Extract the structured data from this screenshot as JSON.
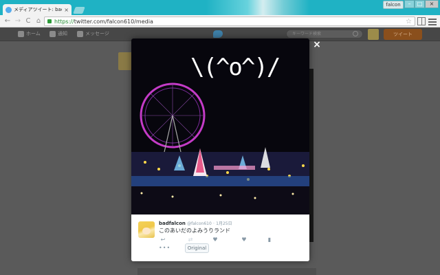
{
  "browser": {
    "tab_title": "メディアツイート: badfalcon",
    "tab_close": "×",
    "url_scheme": "https://",
    "url_rest": "twitter.com/falcon610/media",
    "profile_name": "falcon",
    "window_minimize": "–",
    "window_maximize": "□",
    "window_close": "×",
    "back": "←",
    "forward": "→",
    "reload": "C",
    "home": "⌂",
    "bookmark_star": "☆"
  },
  "twitter_nav": {
    "home": "ホーム",
    "notifications": "通知",
    "messages": "メッセージ",
    "search_placeholder": "キーワード検索",
    "tweet_button": "ツイート"
  },
  "modal": {
    "close": "×",
    "photo_overlay_text": "\\(^o^)/",
    "tweet": {
      "display_name": "badfalcon",
      "handle": "@falcon610",
      "dot": "·",
      "date": "1月25日",
      "text": "このあいだのよみうりランド",
      "more": "•••",
      "original_button": "Original"
    },
    "actions": {
      "reply": "↩",
      "retweet": "⇄",
      "favorite": "♥",
      "like": "♥",
      "stats": "▮"
    }
  },
  "colors": {
    "chrome_frame": "#1fb2c4",
    "twitter_blue": "#55acee",
    "tweet_button_dim": "#8a4f1c",
    "photo_background": "#07060d"
  },
  "icons": [
    "twitter-favicon",
    "lock-icon",
    "star-icon",
    "extension-icon",
    "menu-icon",
    "home-icon",
    "bell-icon",
    "envelope-icon",
    "twitter-bird-icon",
    "search-icon",
    "reply-icon",
    "retweet-icon",
    "favorite-icon",
    "heart-icon",
    "stats-icon",
    "more-icon",
    "close-icon"
  ]
}
